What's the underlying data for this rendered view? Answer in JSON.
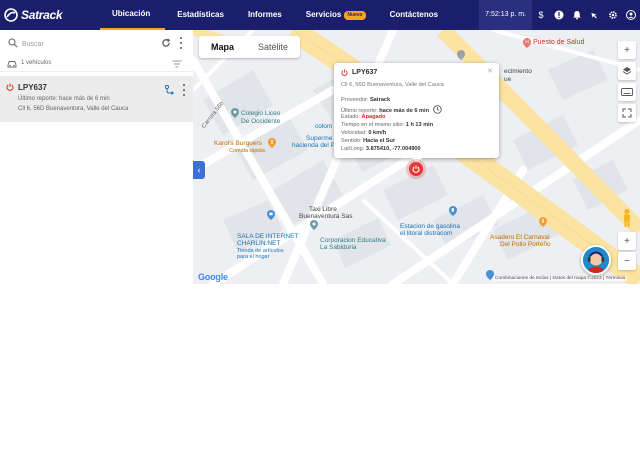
{
  "brand": {
    "name": "Satrack"
  },
  "nav": {
    "items": [
      {
        "label": "Ubicación",
        "active": true
      },
      {
        "label": "Estadísticas"
      },
      {
        "label": "Informes"
      },
      {
        "label": "Servicios",
        "badge": "Nuevo"
      },
      {
        "label": "Contáctenos"
      }
    ]
  },
  "topbar": {
    "clock": "7:52:13 p. m.",
    "icons": [
      "dollar-icon",
      "alert-icon",
      "bell-icon",
      "cursor-icon",
      "settings-icon",
      "user-icon"
    ]
  },
  "sidebar": {
    "search_placeholder": "Buscar",
    "vehicle_count": "1 vehículos",
    "vehicle": {
      "plate": "LPY637",
      "last_report": "Último reporte: hace más de 6 min",
      "address": "Cll 6, 56D Buenaventura, Valle del Cauca",
      "status_color": "#e53935"
    }
  },
  "map": {
    "tabs": [
      "Mapa",
      "Satélite"
    ],
    "active_tab": "Mapa",
    "popup": {
      "plate": "LPY637",
      "address": "Cll 6, 56D Buenaventura, Valle del Cauca",
      "provider_label": "Proveedor:",
      "provider": "Satrack",
      "last_report_label": "Último reporte:",
      "last_report": "hace más de 6 min",
      "state_label": "Estado:",
      "state": "Apagado",
      "time_label": "Tiempo en el mismo sitio:",
      "time": "1 h 13 min",
      "speed_label": "Velocidad:",
      "speed": "0 km/h",
      "direction_label": "Sentido:",
      "direction": "Hacia el Sur",
      "latlong_label": "Lat/Long:",
      "latlong": "3.875410, -77.004900"
    },
    "labels": {
      "puesto_salud": "Puesto de Salud",
      "ecimiento": "ecimiento",
      "ue": "ue",
      "colegio_1": "Colegio Liceo",
      "colegio_2": "De Occidente",
      "karols": "Karol's Burguers",
      "comida": "Comida rápida",
      "super_1": "Superme",
      "super_2": "colom",
      "super_3": "hacienda del P",
      "carrera": "Carrera 56b",
      "taxi_1": "Taxi Libre",
      "taxi_2": "Buenaventura Sas",
      "sala_1": "SALA DE INTERNET",
      "sala_2": "CHARLIN.NET",
      "sala_3": "Tienda de artículos",
      "sala_4": "para el hogar",
      "corp_1": "Corporacion Educativa",
      "corp_2": "La Sabiduria",
      "gas_1": "Estacion de gasolina",
      "gas_2": "el litoral distracom",
      "asadero_1": "Asadero El Carnaval",
      "asadero_2": "Del Pollo Porteño",
      "google": "Google",
      "attribution": "Combinaciones de teclas  |  Datos del mapa ©2023  |  Términos"
    }
  }
}
